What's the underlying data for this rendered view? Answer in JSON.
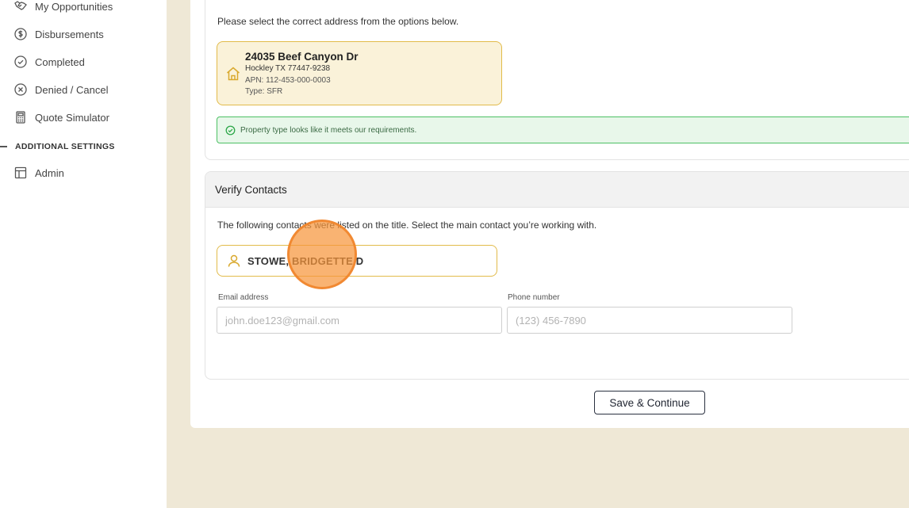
{
  "sidebar": {
    "items": [
      {
        "label": "My Opportunities",
        "icon": "handshake-icon"
      },
      {
        "label": "Disbursements",
        "icon": "dollar-circle-icon"
      },
      {
        "label": "Completed",
        "icon": "check-circle-icon"
      },
      {
        "label": "Denied / Cancel",
        "icon": "x-circle-icon"
      },
      {
        "label": "Quote Simulator",
        "icon": "calculator-icon"
      }
    ],
    "section_title": "ADDITIONAL SETTINGS",
    "admin": {
      "label": "Admin",
      "icon": "layout-icon"
    }
  },
  "address_section": {
    "instruction": "Please select the correct address from the options below.",
    "option": {
      "street": "24035 Beef Canyon Dr",
      "city_line": "Hockley TX 77447-9238",
      "apn": "APN: 112-453-000-0003",
      "type": "Type: SFR"
    },
    "success_message": "Property type looks like it meets our requirements."
  },
  "contacts_section": {
    "title": "Verify Contacts",
    "instruction": "The following contacts were listed on the title. Select the main contact you’re working with.",
    "contact_name": "STOWE, BRIDGETTE D",
    "email_label": "Email address",
    "email_placeholder": "john.doe123@gmail.com",
    "phone_label": "Phone number",
    "phone_placeholder": "(123) 456-7890"
  },
  "actions": {
    "save_label": "Save & Continue"
  },
  "colors": {
    "accent_gold": "#e2bb4a",
    "selected_bg": "#faf2d9",
    "success_border": "#4cc064",
    "page_bg": "#efe8d6"
  }
}
